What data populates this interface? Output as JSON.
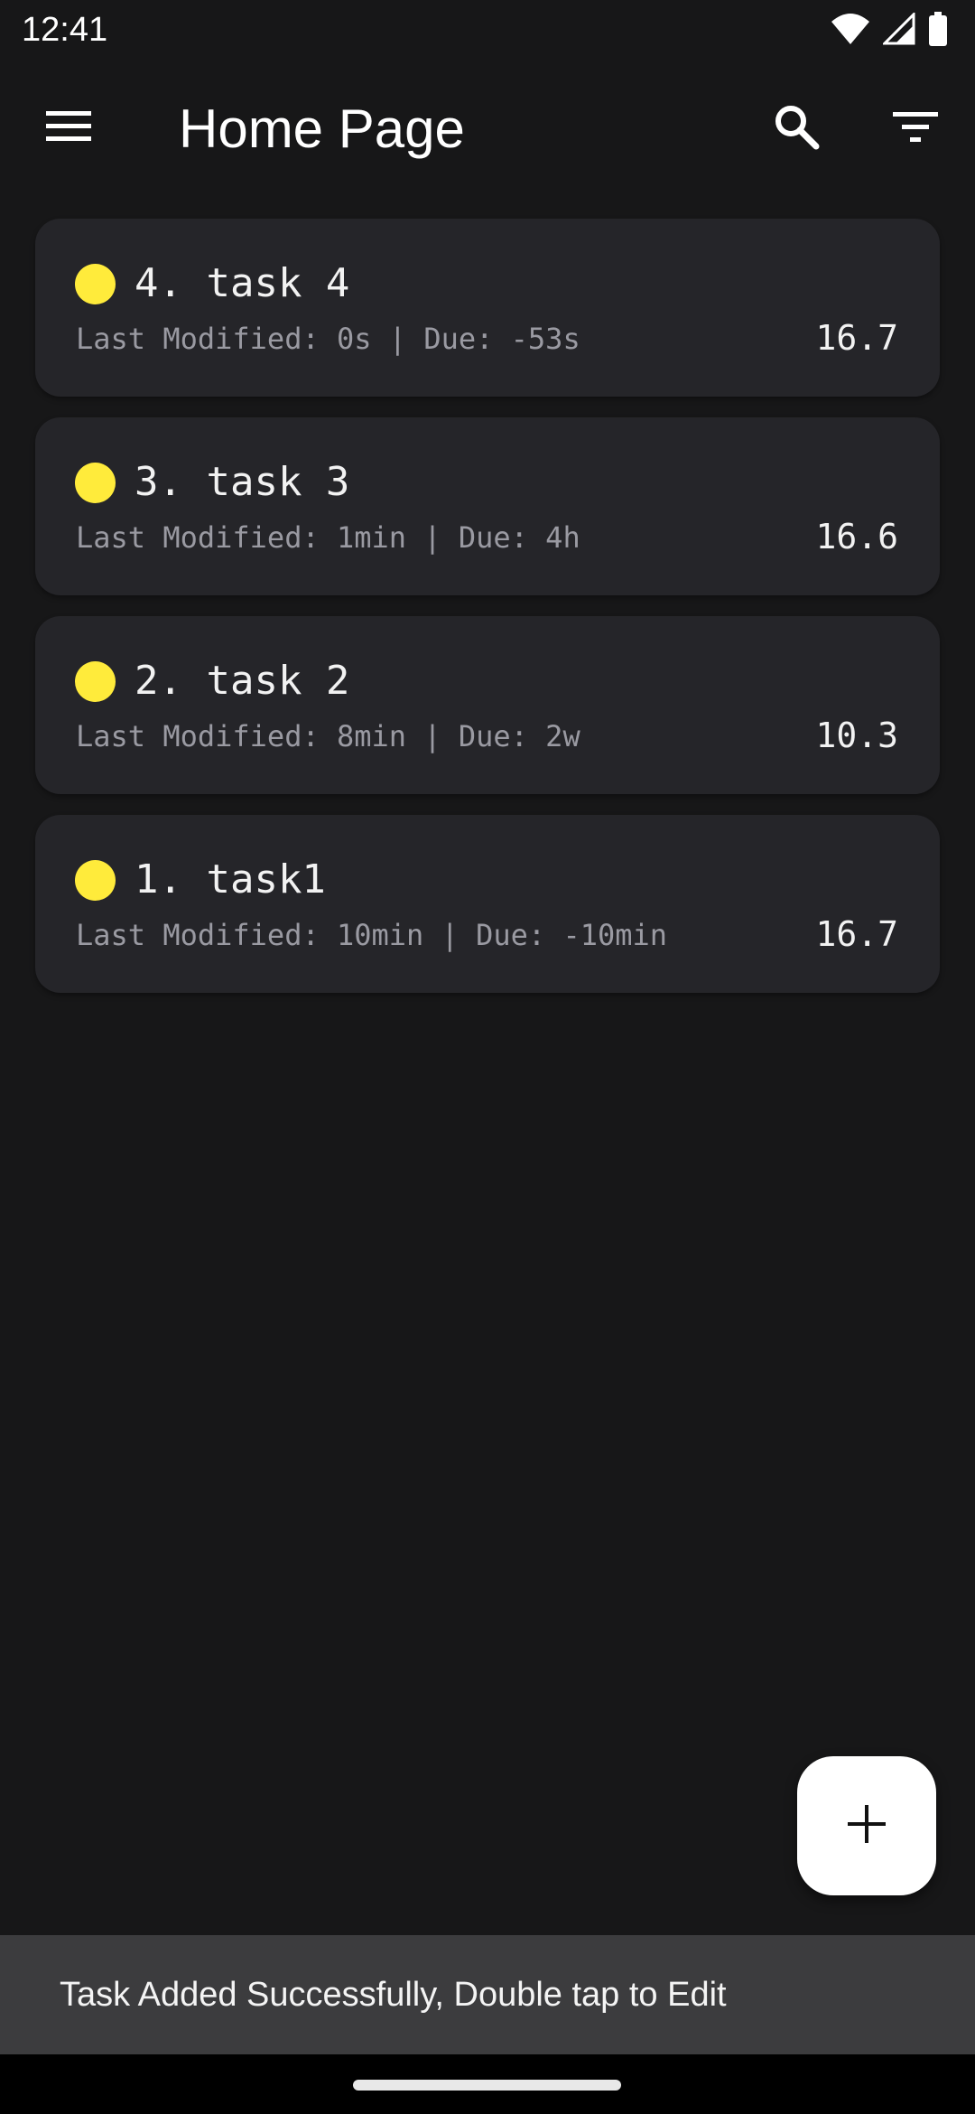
{
  "status_bar": {
    "time": "12:41",
    "icons": [
      "wifi-icon",
      "signal-icon",
      "battery-icon"
    ]
  },
  "app_bar": {
    "title": "Home Page",
    "menu_icon": "menu-icon",
    "search_icon": "search-icon",
    "filter_icon": "filter-icon"
  },
  "tasks": [
    {
      "title": "4. task 4",
      "meta": "Last Modified: 0s | Due: -53s",
      "score": "16.7",
      "dot_color": "#FFEB3B"
    },
    {
      "title": "3. task 3",
      "meta": "Last Modified: 1min | Due: 4h",
      "score": "16.6",
      "dot_color": "#FFEB3B"
    },
    {
      "title": "2. task 2",
      "meta": "Last Modified: 8min | Due: 2w",
      "score": "10.3",
      "dot_color": "#FFEB3B"
    },
    {
      "title": "1. task1",
      "meta": "Last Modified: 10min | Due: -10min",
      "score": "16.7",
      "dot_color": "#FFEB3B"
    }
  ],
  "fab": {
    "icon": "plus-icon"
  },
  "snackbar": {
    "message": "Task Added Successfully, Double tap to Edit"
  },
  "colors": {
    "background": "#171718",
    "card": "#252529",
    "snackbar": "#3C3C3E",
    "accent_dot": "#FFEB3B"
  }
}
